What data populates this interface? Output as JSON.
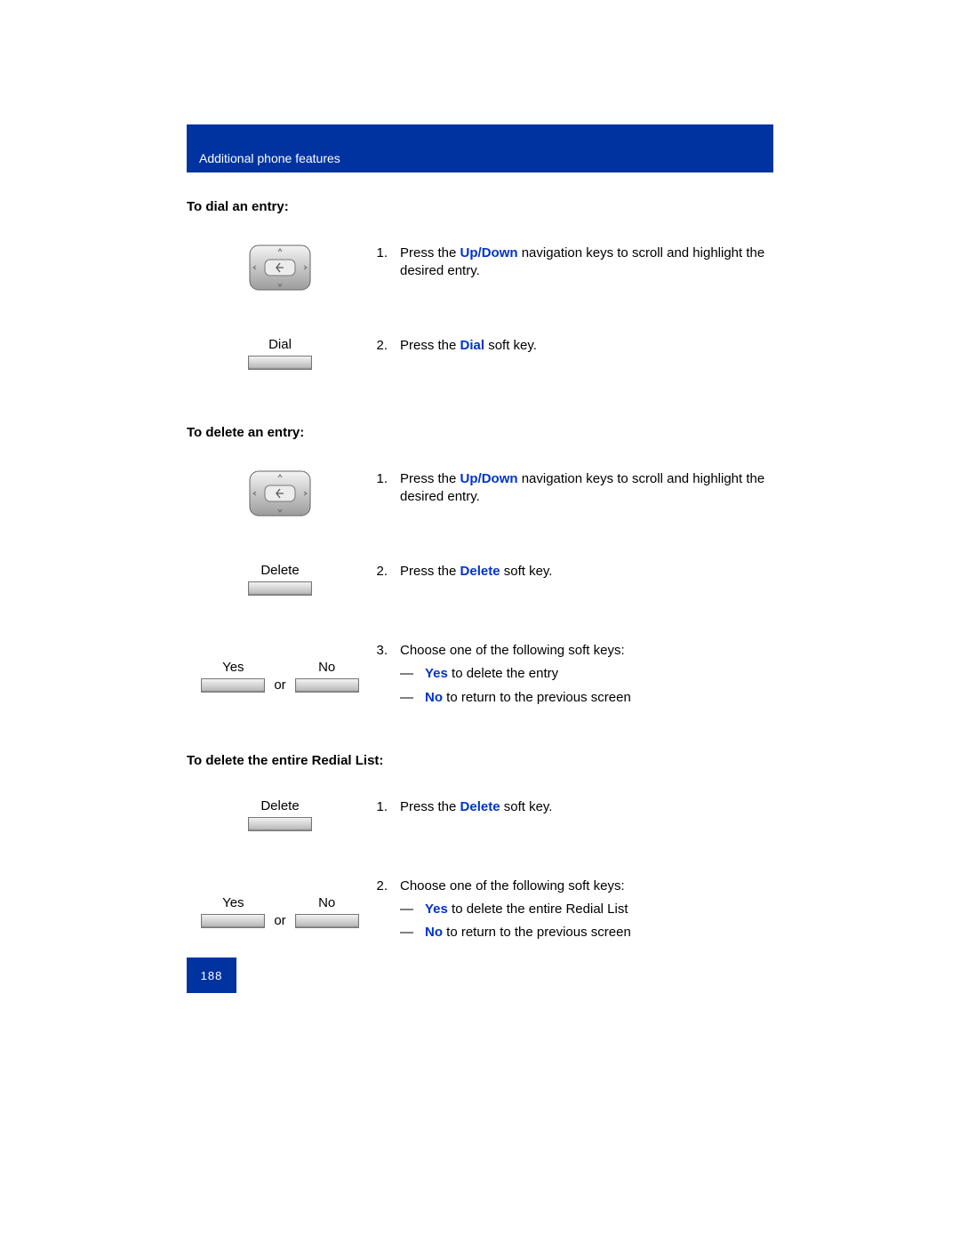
{
  "header": {
    "title": "Additional phone features"
  },
  "page_number": "188",
  "sections": {
    "dial": {
      "heading": "To dial an entry:",
      "step1": {
        "num": "1.",
        "pre": "Press the ",
        "kw": "Up/Down",
        "post": " navigation keys to scroll and highlight the desired entry."
      },
      "step2": {
        "num": "2.",
        "pre": "Press the ",
        "kw": "Dial",
        "post": " soft key."
      },
      "key_label": "Dial"
    },
    "delete_entry": {
      "heading": "To delete an entry:",
      "step1": {
        "num": "1.",
        "pre": "Press the ",
        "kw": "Up/Down",
        "post": " navigation keys to scroll and highlight the desired entry."
      },
      "step2": {
        "num": "2.",
        "pre": "Press the ",
        "kw": "Delete",
        "post": " soft key."
      },
      "key_label": "Delete",
      "step3": {
        "num": "3.",
        "lead": "Choose one of the following soft keys:",
        "yes_kw": "Yes",
        "yes_post": " to delete the entry",
        "no_kw": "No",
        "no_post": " to return to the previous screen"
      },
      "yes_label": "Yes",
      "no_label": "No",
      "or": "or"
    },
    "delete_list": {
      "heading": "To delete the entire Redial List:",
      "step1": {
        "num": "1.",
        "pre": "Press the ",
        "kw": "Delete",
        "post": " soft key."
      },
      "key_label": "Delete",
      "step2": {
        "num": "2.",
        "lead": "Choose one of the following soft keys:",
        "yes_kw": "Yes",
        "yes_post": " to delete the entire Redial List",
        "no_kw": "No",
        "no_post": " to return to the previous screen"
      },
      "yes_label": "Yes",
      "no_label": "No",
      "or": "or"
    }
  },
  "dash": "—"
}
